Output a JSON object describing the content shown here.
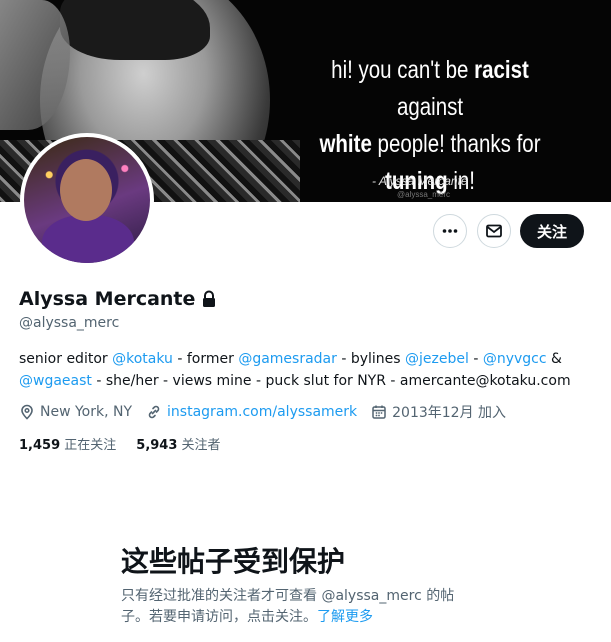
{
  "banner": {
    "quote_1": "hi! you can't be ",
    "quote_1_bold": "racist",
    "quote_1_end": " against",
    "quote_2_bold": "white",
    "quote_2_end": " people! thanks for",
    "quote_3_bold": "tuning",
    "quote_3_end": " in!",
    "attribution": "- Alyssa Mercante",
    "watermark": "@alyssa_merc"
  },
  "actions": {
    "follow_label": "关注",
    "more_icon": "more-icon",
    "message_icon": "envelope-icon"
  },
  "profile": {
    "name": "Alyssa Mercante",
    "lock_icon": "lock-icon",
    "handle": "@alyssa_merc",
    "bio": {
      "t1": "senior editor ",
      "m1": "@kotaku",
      "t2": " - former ",
      "m2": "@gamesradar",
      "t3": " - bylines ",
      "m3": "@jezebel",
      "t4": " - ",
      "m4": "@nyvgcc",
      "t5": " &",
      "m5": "@wgaeast",
      "t6": " - she/her - views mine - puck slut for NYR - amercante@kotaku.com"
    },
    "location": "New York, NY",
    "website": "instagram.com/alyssamerk",
    "joined": "2013年12月 加入",
    "following_count": "1,459",
    "following_label": "正在关注",
    "followers_count": "5,943",
    "followers_label": "关注者"
  },
  "protected": {
    "title": "这些帖子受到保护",
    "text": "只有经过批准的关注者才可查看 @alyssa_merc 的帖子。若要申请访问，点击关注。",
    "learn_more": "了解更多"
  },
  "colors": {
    "accent": "#1d9bf0",
    "text": "#0f1419",
    "muted": "#536471"
  }
}
